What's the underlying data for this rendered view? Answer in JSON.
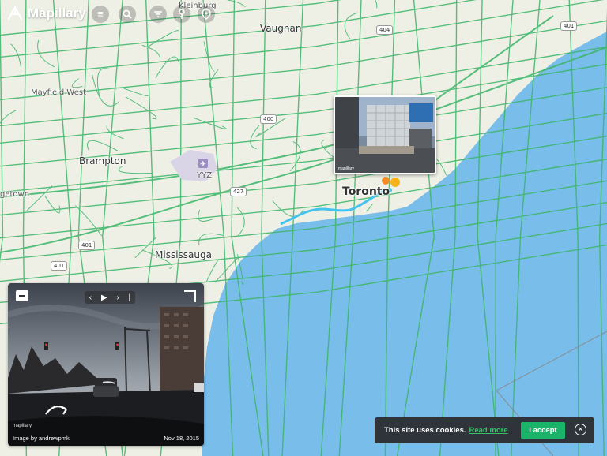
{
  "app": {
    "name": "Mapillary",
    "menu_icon": "menu-icon",
    "search_icon": "search-icon",
    "filter_icon": "filter-icon",
    "sequence_icon": "sequence-icon",
    "location_icon": "location-pin-icon"
  },
  "map": {
    "water_color": "#79bdea",
    "land_color": "#eef0e6",
    "coverage_color": "#3bb566",
    "selected_sequence_color": "#44c3ee",
    "labels": {
      "kleinburg": "Kleinburg",
      "vaughan": "Vaughan",
      "mayfield_west": "Mayfield West",
      "brampton": "Brampton",
      "yyz": "YYZ",
      "georgetown": "getown",
      "mississauga": "Mississauga",
      "toronto": "Toronto"
    },
    "highways": {
      "h400": "400",
      "h404": "404",
      "h401_east": "401",
      "h427": "427",
      "h401_west": "401",
      "h401_sw": "401"
    }
  },
  "popup": {
    "credit": "mapillary"
  },
  "viewer": {
    "credit": "Image by andrewpmk",
    "date": "Nov 18, 2015",
    "watermark": "mapillary",
    "prev_icon": "chevron-left-icon",
    "play_icon": "play-icon",
    "next_icon": "chevron-right-icon"
  },
  "cookie": {
    "message": "This site uses cookies.",
    "link_text": "Read more",
    "link_suffix": ".",
    "accept_label": "I accept",
    "close_icon": "close-circle-icon"
  }
}
